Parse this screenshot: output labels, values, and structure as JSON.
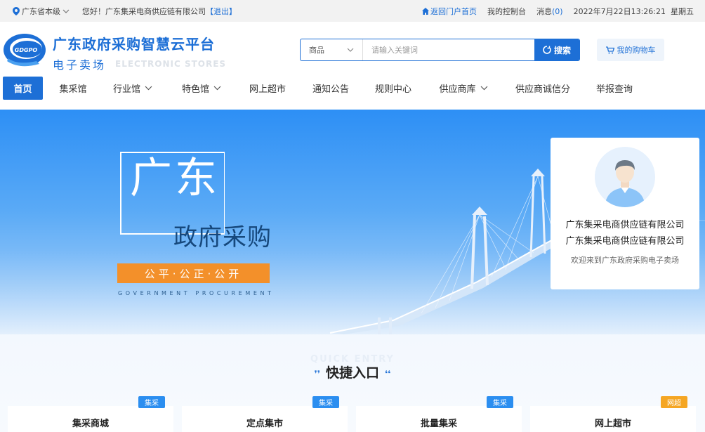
{
  "topbar": {
    "location": "广东省本级",
    "greeting": "您好！广东集采电商供应链有限公司",
    "logout": "【退出】",
    "portal": "返回门户首页",
    "console": "我的控制台",
    "messages_label": "消息",
    "messages_count": "(0)",
    "datetime": "2022年7月22日13:26:21  星期五"
  },
  "header": {
    "logo_text": "GDGPO",
    "title": "广东政府采购智慧云平台",
    "subtitle": "电子卖场",
    "subtitle_en": "ELECTRONIC STORES",
    "search_category": "商品",
    "search_placeholder": "请输入关键词",
    "search_button": "搜索",
    "cart": "我的购物车"
  },
  "nav": {
    "items": [
      {
        "label": "首页",
        "active": true
      },
      {
        "label": "集采馆"
      },
      {
        "label": "行业馆"
      },
      {
        "label": "特色馆"
      },
      {
        "label": "网上超市"
      },
      {
        "label": "通知公告"
      },
      {
        "label": "规则中心"
      },
      {
        "label": "供应商库"
      },
      {
        "label": "供应商诚信分"
      },
      {
        "label": "举报查询"
      }
    ]
  },
  "banner": {
    "title_big": "广东",
    "title_mid": "政府采购",
    "tagline": "公平·公正·公开",
    "tagline_en": "GOVERNMENT PROCUREMENT"
  },
  "user_card": {
    "name_line1": "广东集采电商供应链有限公司",
    "name_line2": "广东集采电商供应链有限公司",
    "welcome": "欢迎来到广东政府采购电子卖场"
  },
  "quick_entry": {
    "title_en": "QUICK ENTRY",
    "title": "快捷入口",
    "cards": [
      {
        "label": "集采商城",
        "badge": "集采"
      },
      {
        "label": "定点集市",
        "badge": "集采"
      },
      {
        "label": "批量集采",
        "badge": "集采"
      },
      {
        "label": "网上超市",
        "badge": "网超"
      }
    ]
  },
  "colors": {
    "primary": "#1d6fd6",
    "accent_orange": "#f3902a",
    "badge_blue": "#2b8ef0",
    "badge_orange": "#f5a623"
  }
}
